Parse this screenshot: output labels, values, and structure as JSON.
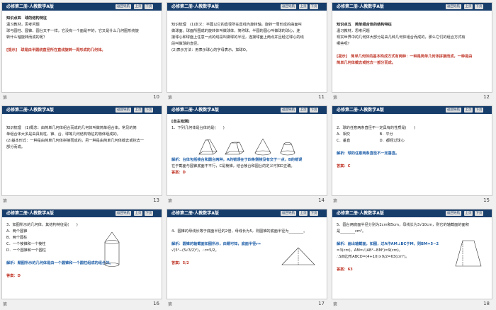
{
  "header": {
    "title": "必修第二册·人教数学A版",
    "nav": "返回导航",
    "prev": "上页",
    "next": "下页"
  },
  "slides": [
    {
      "num": "10",
      "label": "第",
      "lines": [
        {
          "t": "知识点四　球的结构特征",
          "c": "bold"
        },
        {
          "t": "温习教材，思考问题",
          "c": ""
        },
        {
          "t": "球与圆柱、圆锥、圆台又不一样，它没有一个面是平的，它又是什么几何图形绕旋",
          "c": ""
        },
        {
          "t": "转什么轴旋转而成的呢？",
          "c": ""
        },
        {
          "t": "",
          "c": ""
        },
        {
          "t": "[提示]　球是由半圆绕直径所在直线旋转一周形成的几何体。",
          "c": "red"
        }
      ]
    },
    {
      "num": "11",
      "label": "第",
      "lines": [
        {
          "t": "",
          "c": ""
        },
        {
          "t": "知识梳理　(1)定义：半圆以它的直径所在直线为旋转轴，旋转一周形成的曲面叫",
          "c": ""
        },
        {
          "t": "做球面。球面所围成的旋转体叫做球体，简称球。半圆的圆心叫做球的球心，连",
          "c": ""
        },
        {
          "t": "接球心和球面上任意一点的线段叫做球的半径，连接球面上两点并且经过球心的线",
          "c": ""
        },
        {
          "t": "段叫做球的直径。",
          "c": ""
        },
        {
          "t": "(2)表示方法：用表示球心的字母表示，如球O。",
          "c": ""
        }
      ]
    },
    {
      "num": "12",
      "label": "第",
      "lines": [
        {
          "t": "",
          "c": ""
        },
        {
          "t": "知识点五　简单组合体的结构特征",
          "c": "bold"
        },
        {
          "t": "温习教材，思考问题",
          "c": ""
        },
        {
          "t": "现实世界中的几何体大部分是由几种几何体组合而成的，那么它们的组合方式有",
          "c": ""
        },
        {
          "t": "哪些呢？",
          "c": ""
        },
        {
          "t": "",
          "c": ""
        },
        {
          "t": "[提示]　简单几何体的基本构成方式有两种：一种是简单几何体拼接而成，一种是由",
          "c": "red"
        },
        {
          "t": "简单几何体截去或挖去一部分而成。",
          "c": "red"
        }
      ]
    },
    {
      "num": "13",
      "label": "第",
      "lines": [
        {
          "t": "",
          "c": ""
        },
        {
          "t": "知识梳理　(1)概念：由简单几何体组合而成的几何体叫做简单组合体。常见的简",
          "c": ""
        },
        {
          "t": "单组合体大多是由具有柱、锥、台、球等几何结构特征的物体组成的。",
          "c": ""
        },
        {
          "t": "(2)基本形式：一种是由简单几何体拼接而成的，另一种是由简单几何体截去或挖去一",
          "c": ""
        },
        {
          "t": "部分而成。",
          "c": ""
        }
      ]
    },
    {
      "num": "14",
      "label": "第",
      "lines": [
        {
          "t": "[自主检测]",
          "c": "bold"
        },
        {
          "t": "1．下列几何体是台体的是(　　)",
          "c": ""
        },
        {
          "t": "",
          "c": ""
        },
        {
          "t": "",
          "c": ""
        },
        {
          "t": "",
          "c": ""
        },
        {
          "t": "",
          "c": ""
        },
        {
          "t": "解析：台体包括棱台和圆台两种，A的错误在于四条侧棱没有交于一点，B的错误",
          "c": "blue"
        },
        {
          "t": "在于截面与圆锥底面不平行，C是棱锥，结合棱台和圆台的定义可知D正确。",
          "c": ""
        },
        {
          "t": "答案：D",
          "c": "red"
        }
      ]
    },
    {
      "num": "15",
      "label": "第",
      "lines": [
        {
          "t": "",
          "c": ""
        },
        {
          "t": "2．球的任意两条直径不一定具有的性质是(　　)",
          "c": ""
        },
        {
          "t": "A．相交　　　　　　　　B．平分",
          "c": ""
        },
        {
          "t": "C．垂直　　　　　　　　D．都经过球心",
          "c": ""
        },
        {
          "t": "",
          "c": ""
        },
        {
          "t": "解析：球的任意两条直径不一定垂直。",
          "c": "blue"
        },
        {
          "t": "",
          "c": ""
        },
        {
          "t": "答案：C",
          "c": "red"
        }
      ]
    },
    {
      "num": "16",
      "label": "第",
      "lines": [
        {
          "t": "3．如图所示的几何体，其结构特征是(　　)",
          "c": ""
        },
        {
          "t": "A．两个圆锥",
          "c": ""
        },
        {
          "t": "B．两个圆柱",
          "c": ""
        },
        {
          "t": "C．一个棱锥和一个棱柱",
          "c": ""
        },
        {
          "t": "D．一个圆锥和一个圆柱",
          "c": ""
        },
        {
          "t": "",
          "c": ""
        },
        {
          "t": "解析：题图所示的几何体是由一个圆锥和一个圆柱组成的组合体。",
          "c": "blue"
        },
        {
          "t": "",
          "c": ""
        },
        {
          "t": "答案：D",
          "c": "red"
        }
      ]
    },
    {
      "num": "17",
      "label": "第",
      "lines": [
        {
          "t": "",
          "c": ""
        },
        {
          "t": "4．圆锥的母线长等于底面半径的2倍，母线长为5，则圆锥的底面半径为________。",
          "c": ""
        },
        {
          "t": "",
          "c": ""
        },
        {
          "t": "解析：圆锥的轴截面如图所示，由题可知，底面半径r=",
          "c": "blue"
        },
        {
          "t": "√(5²−(5√3/2)²)，∴r=5/2。",
          "c": ""
        },
        {
          "t": "",
          "c": ""
        },
        {
          "t": "答案：5/2",
          "c": "red"
        }
      ]
    },
    {
      "num": "18",
      "label": "第",
      "lines": [
        {
          "t": "5．圆台两底面半径分别为2cm和5cm，母线长为3√10cm，则它的轴截面的面积",
          "c": ""
        },
        {
          "t": "是________cm²。",
          "c": ""
        },
        {
          "t": "",
          "c": ""
        },
        {
          "t": "解析：画出轴截面，如图，过A作AM⊥BC于M，则BM=5−2",
          "c": "blue"
        },
        {
          "t": "=3(cm)，AM=√(AB²−BM²)=9(cm)，",
          "c": ""
        },
        {
          "t": "∴S四边形ABCD=(4+10)×9/2=63(cm²)。",
          "c": ""
        },
        {
          "t": "",
          "c": ""
        },
        {
          "t": "答案：63",
          "c": "red"
        }
      ]
    }
  ]
}
